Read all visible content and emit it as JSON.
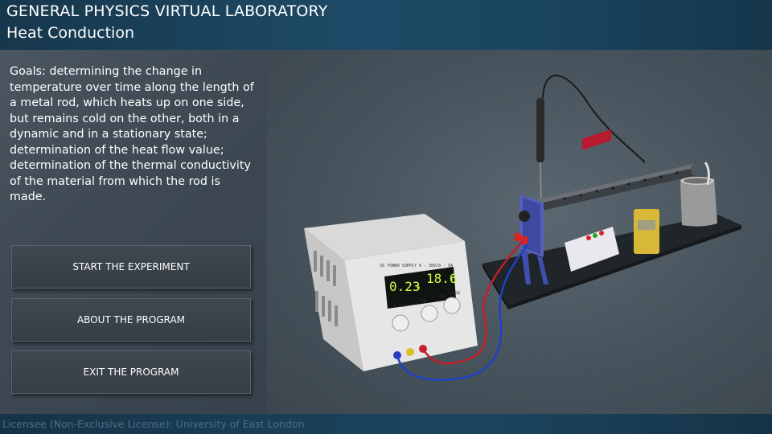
{
  "header": {
    "title": "GENERAL PHYSICS VIRTUAL LABORATORY",
    "subtitle": "Heat Conduction"
  },
  "goals_text": "Goals: determining the change in temperature over time along the length of a metal rod, which heats up on one side, but remains cold on the other, both in a dynamic and in a stationary state; determination of the heat flow value; determination of the thermal conductivity of the material from which the rod is made.",
  "menu": {
    "start": "START THE EXPERIMENT",
    "about": "ABOUT THE PROGRAM",
    "exit": "EXIT THE PROGRAM"
  },
  "footer": {
    "license": "Licensee (Non-Exclusive License): University of East London"
  },
  "power_supply": {
    "label": "DC POWER SUPPLY 0 - 30V/0 - 5A",
    "current_reading": "0.23",
    "current_unit": "A",
    "voltage_reading": "18.6",
    "voltage_unit": "V",
    "knob_label_current": "0 - 5A",
    "knob_label_fine": "FINE",
    "knob_label_voltage": "0 - 30V",
    "knob_label_coarse": "COARSE"
  },
  "colors": {
    "header_bg": "#1d4a66",
    "display_green": "#c8ff4a",
    "wire_red": "#c0202a",
    "wire_blue": "#2040c8"
  }
}
